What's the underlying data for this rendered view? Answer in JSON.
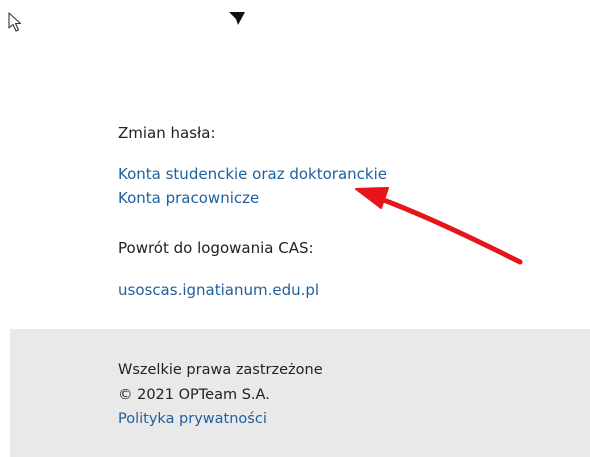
{
  "password_change": {
    "heading": "Zmian hasła:",
    "links": [
      "Konta studenckie oraz doktoranckie",
      "Konta pracownicze"
    ]
  },
  "cas_return": {
    "heading": "Powrót do logowania CAS:",
    "link": "usoscas.ignatianum.edu.pl"
  },
  "footer": {
    "rights": "Wszelkie prawa zastrzeżone",
    "copyright": "© 2021 OPTeam S.A.",
    "privacy_link": "Polityka prywatności"
  },
  "colors": {
    "link": "#1f5f9e",
    "text": "#222222",
    "footer_bg": "#e9e9e9",
    "annotation_arrow": "#e8141b"
  },
  "icons": {
    "cursor": "mouse-pointer-icon",
    "logo_fragment": "logo-fragment-icon",
    "annotation": "red-arrow-annotation"
  }
}
